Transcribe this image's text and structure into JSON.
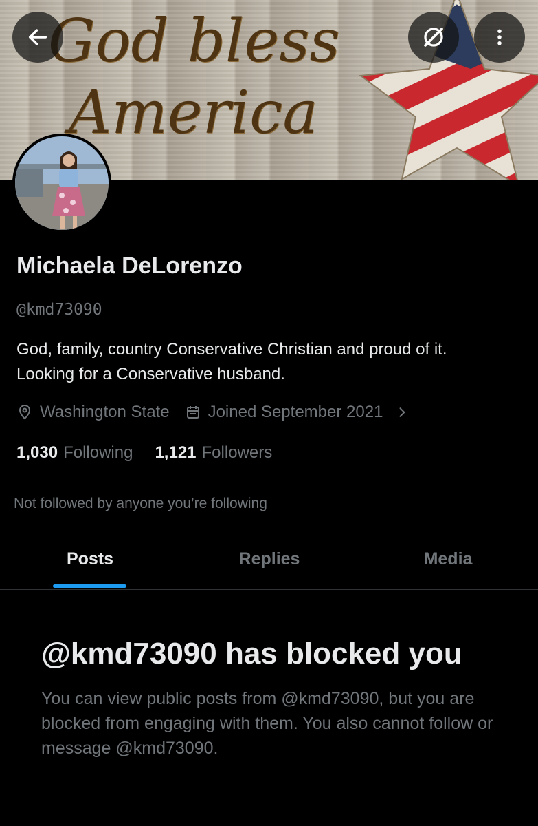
{
  "banner": {
    "line1": "God bless",
    "line2": "America",
    "colors": {
      "wood": "#bdb5a8",
      "lettering": "#4e3413",
      "flag_red": "#c8282e",
      "flag_blue": "#2d3c5c"
    }
  },
  "header": {
    "back_icon": "arrow-left-icon",
    "grok_icon": "grok-slash-icon",
    "more_icon": "more-vertical-icon"
  },
  "profile": {
    "name": "Michaela DeLorenzo",
    "handle": "@kmd73090",
    "bio_line1": "God, family, country Conservative Christian and proud of it.",
    "bio_line2": "Looking for a Conservative husband.",
    "location": "Washington State",
    "joined": "Joined September 2021",
    "following_count": "1,030",
    "following_label": "Following",
    "followers_count": "1,121",
    "followers_label": "Followers",
    "not_followed": "Not followed by anyone you’re following"
  },
  "tabs": [
    {
      "label": "Posts",
      "active": true
    },
    {
      "label": "Replies",
      "active": false
    },
    {
      "label": "Media",
      "active": false
    }
  ],
  "blocked": {
    "title": "@kmd73090 has blocked you",
    "body": "You can view public posts from @kmd73090, but you are blocked from engaging with them. You also cannot follow or message @kmd73090."
  },
  "theme": {
    "background": "#000000",
    "text": "#e7e9ea",
    "muted": "#71767b",
    "accent": "#1d9bf0",
    "divider": "#2f3336"
  }
}
